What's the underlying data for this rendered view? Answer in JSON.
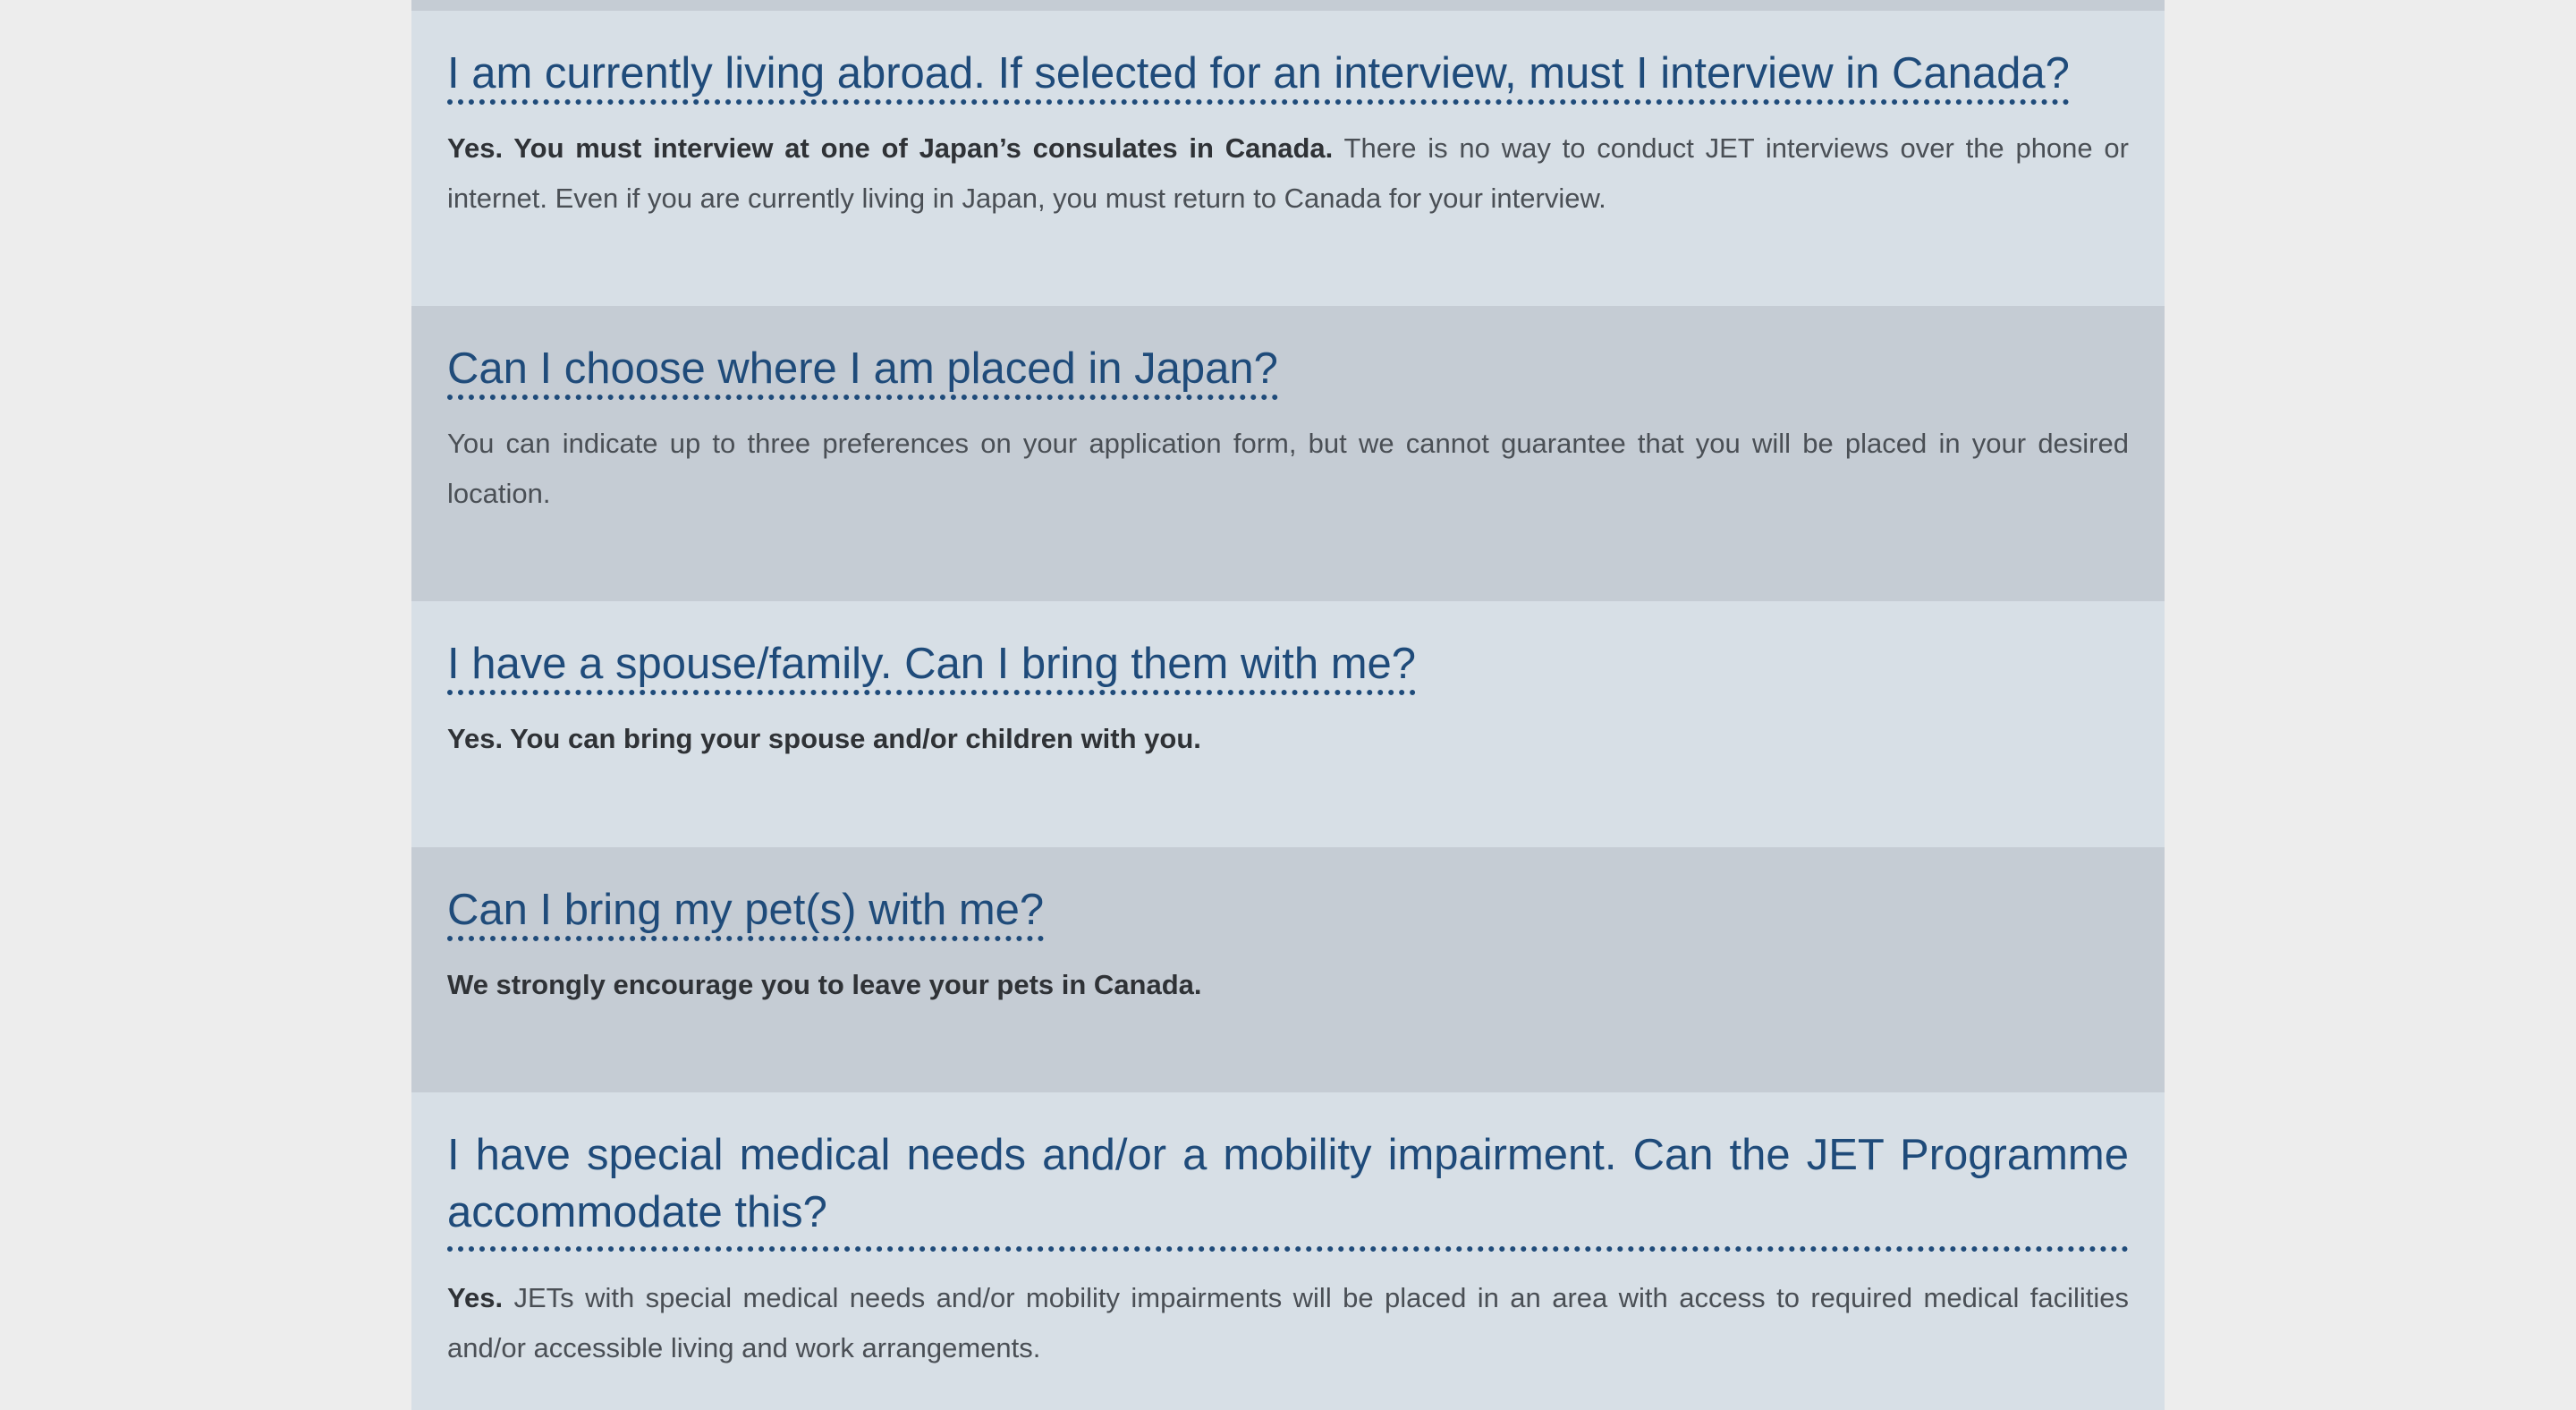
{
  "faq": [
    {
      "question": "I am currently living abroad. If selected for an interview, must I interview in Canada?",
      "answer_bold": "Yes. You must interview at one of Japan’s consulates in Canada.",
      "answer_text": " There is no way to conduct JET interviews over the phone or internet. Even if you are currently living in Japan, you must return to Canada for your interview."
    },
    {
      "question": "Can I choose where I am placed in Japan?",
      "answer_bold": "",
      "answer_text": "You can indicate up to three preferences on your application form, but we cannot guarantee that you will be placed in your desired location."
    },
    {
      "question": "I have a spouse/family. Can I bring them with me?",
      "answer_bold": "Yes. You can bring your spouse and/or children with you.",
      "answer_text": ""
    },
    {
      "question": "Can I bring my pet(s) with me?",
      "answer_bold": "We strongly encourage you to leave your pets in Canada.",
      "answer_text": ""
    },
    {
      "question": "I have special medical needs and/or a mobility impairment. Can the JET Programme accommodate this?",
      "answer_bold": "Yes.",
      "answer_text": " JETs with special medical needs and/or mobility impairments will be placed in an area with access to required medical facilities and/or accessible living and work arrangements."
    }
  ],
  "colors": {
    "background": "#ededed",
    "section_light": "#d7dfe6",
    "section_dark": "#c5ccd4",
    "question_blue": "#1f4b7a",
    "answer_text": "#4a4f55"
  }
}
